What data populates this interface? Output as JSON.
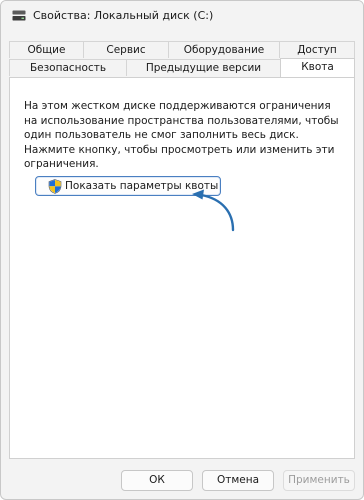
{
  "window": {
    "title": "Свойства: Локальный диск (C:)",
    "icon": "drive-icon"
  },
  "tabs": {
    "row_back": [
      "Общие",
      "Сервис",
      "Оборудование",
      "Доступ"
    ],
    "row_front": [
      "Безопасность",
      "Предыдущие версии",
      "Квота"
    ],
    "active": "Квота"
  },
  "panel": {
    "description": "На этом жестком диске поддерживаются ограничения на использование пространства пользователями, чтобы один пользователь не смог заполнить весь диск. Нажмите кнопку, чтобы просмотреть или изменить эти ограничения.",
    "quota_button": {
      "label": "Показать параметры квоты",
      "icon": "uac-shield-icon"
    }
  },
  "footer": {
    "ok": "ОК",
    "cancel": "Отмена",
    "apply": "Применить",
    "apply_enabled": false
  },
  "colors": {
    "window_bg": "#f3f3f3",
    "panel_bg": "#ffffff",
    "accent_border": "#4a7fc1",
    "annotation_arrow": "#2a6fb0",
    "disabled_text": "#9d9d9d"
  }
}
